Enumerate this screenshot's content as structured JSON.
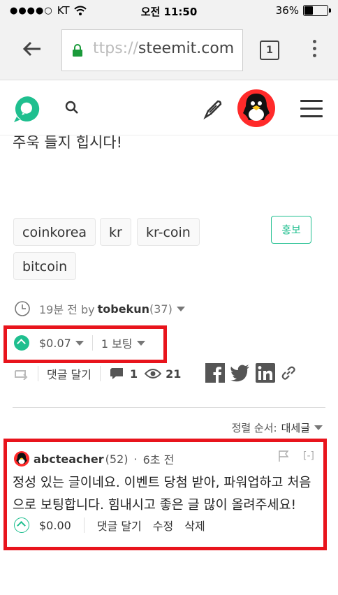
{
  "status_bar": {
    "carrier": "KT",
    "time": "오전 11:50",
    "battery": "36%"
  },
  "browser": {
    "url_faded": "ttps://",
    "url_main": "steemit.com",
    "tab_count": "1"
  },
  "post": {
    "partial_text": "주욱 들지 힙시다!",
    "tags": [
      "coinkorea",
      "kr",
      "kr-coin",
      "bitcoin"
    ],
    "promote_label": "홍보",
    "time_ago": "19분 전 by",
    "author": "tobekun",
    "author_rep": "(37)",
    "payout": "$0.07",
    "votes": "1 보팅",
    "reply_label": "댓글 달기",
    "comment_count": "1",
    "views": "21"
  },
  "comments_section": {
    "sort_label": "정렬 순서:",
    "sort_value": "대세글"
  },
  "comment": {
    "author": "abcteacher",
    "rep": "(52)",
    "separator": "·",
    "time": "6초 전",
    "collapse": "[-]",
    "body": "정성 있는 글이네요. 이벤트 당첨 받아, 파워업하고 처음으로 보팅합니다. 힘내시고 좋은 글 많이 올려주세요!",
    "payout": "$0.00",
    "reply_label": "댓글 달기",
    "edit_label": "수정",
    "delete_label": "삭제"
  },
  "colors": {
    "accent": "#1fbf8f",
    "highlight": "#e8141c"
  }
}
